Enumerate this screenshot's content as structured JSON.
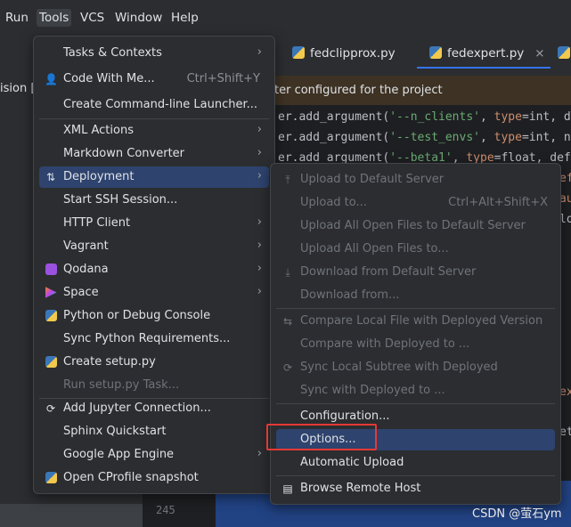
{
  "menubar": {
    "items": [
      "Run",
      "Tools",
      "VCS",
      "Window",
      "Help"
    ]
  },
  "left_panel": {
    "text": "ision [",
    "gutter_line": "245"
  },
  "tabs": [
    {
      "label": "fedclipprox.py"
    },
    {
      "label": "fedexpert.py"
    }
  ],
  "tab_close": "×",
  "banner": {
    "text": "eter configured for the project"
  },
  "code_lines": [
    {
      "pre": "er.add_argument(",
      "str": "'--n_clients'",
      "mid": ", ",
      "kw": "type",
      "post": "=int, d"
    },
    {
      "pre": "er.add_argument(",
      "str": "'--test_envs'",
      "mid": ", ",
      "kw": "type",
      "post": "=int, n"
    },
    {
      "pre": "er.add_argument(",
      "str": "'--beta1'",
      "mid": ", ",
      "kw": "type",
      "post": "=float, def"
    }
  ],
  "code_fragments": [
    "ef",
    "au",
    "lo",
    "ex",
    "et"
  ],
  "tools_menu": {
    "items": [
      {
        "label": "Tasks & Contexts",
        "icon": "",
        "submenu": true
      },
      {
        "label": "Code With Me...",
        "icon": "user-plus-icon",
        "shortcut": "Ctrl+Shift+Y"
      },
      {
        "label": "Create Command-line Launcher..."
      },
      {
        "label": "XML Actions",
        "submenu": true
      },
      {
        "label": "Markdown Converter",
        "submenu": true
      },
      {
        "label": "Deployment",
        "icon": "deployment-icon",
        "submenu": true,
        "selected": true
      },
      {
        "label": "Start SSH Session..."
      },
      {
        "label": "HTTP Client",
        "submenu": true
      },
      {
        "label": "Vagrant",
        "submenu": true
      },
      {
        "label": "Qodana",
        "icon": "qodana-icon",
        "submenu": true
      },
      {
        "label": "Space",
        "icon": "space-icon",
        "submenu": true
      },
      {
        "label": "Python or Debug Console",
        "icon": "python-icon"
      },
      {
        "label": "Sync Python Requirements..."
      },
      {
        "label": "Create setup.py",
        "icon": "python-icon"
      },
      {
        "label": "Run setup.py Task...",
        "disabled": true
      },
      {
        "label": "Add Jupyter Connection...",
        "icon": "jupyter-icon"
      },
      {
        "label": "Sphinx Quickstart"
      },
      {
        "label": "Google App Engine",
        "submenu": true
      },
      {
        "label": "Open CProfile snapshot",
        "icon": "python-icon"
      }
    ]
  },
  "deployment_menu": {
    "items": [
      {
        "label": "Upload to Default Server",
        "disabled": true,
        "icon": "upload-icon"
      },
      {
        "label": "Upload to...",
        "disabled": true,
        "shortcut": "Ctrl+Alt+Shift+X"
      },
      {
        "label": "Upload All Open Files to Default Server",
        "disabled": true
      },
      {
        "label": "Upload All Open Files to...",
        "disabled": true
      },
      {
        "label": "Download from Default Server",
        "disabled": true,
        "icon": "download-icon"
      },
      {
        "label": "Download from...",
        "disabled": true
      },
      {
        "label": "Compare Local File with Deployed Version",
        "disabled": true,
        "icon": "compare-icon"
      },
      {
        "label": "Compare with Deployed to ...",
        "disabled": true
      },
      {
        "label": "Sync Local Subtree with Deployed",
        "disabled": true,
        "icon": "sync-icon"
      },
      {
        "label": "Sync with Deployed to ...",
        "disabled": true
      },
      {
        "label": "Configuration..."
      },
      {
        "label": "Options...",
        "hover": true
      },
      {
        "label": "Automatic Upload"
      },
      {
        "label": "Browse Remote Host",
        "icon": "remote-host-icon"
      }
    ]
  },
  "watermark": "CSDN @萤石ym",
  "colors": {
    "accent": "#3574f0",
    "selection": "#2e436e",
    "highlight_box": "#e53935"
  }
}
